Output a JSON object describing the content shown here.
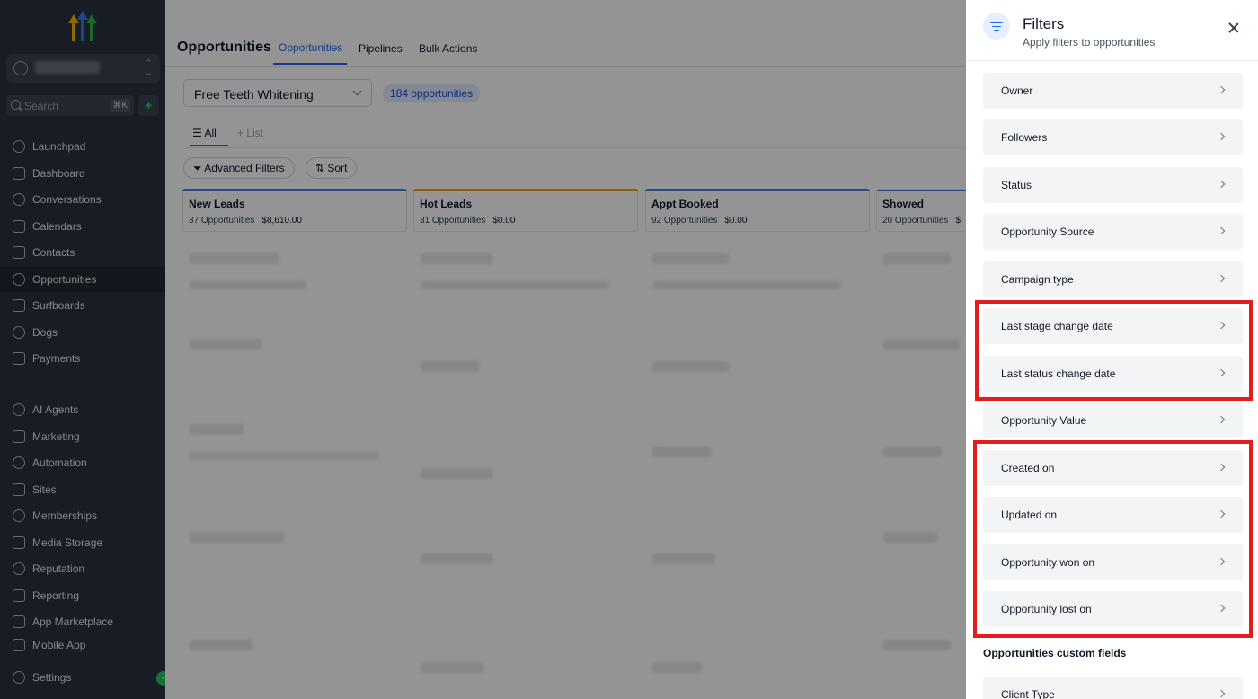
{
  "sidebar": {
    "search_placeholder": "Search",
    "search_shortcut": "⌘K",
    "items": [
      {
        "label": "Launchpad",
        "icon": "launchpad-icon"
      },
      {
        "label": "Dashboard",
        "icon": "dashboard-icon"
      },
      {
        "label": "Conversations",
        "icon": "chat-icon"
      },
      {
        "label": "Calendars",
        "icon": "calendar-icon"
      },
      {
        "label": "Contacts",
        "icon": "contacts-icon"
      },
      {
        "label": "Opportunities",
        "icon": "opportunities-icon",
        "active": true
      },
      {
        "label": "Surfboards",
        "icon": "surfboard-icon"
      },
      {
        "label": "Dogs",
        "icon": "dog-icon"
      },
      {
        "label": "Payments",
        "icon": "payments-icon"
      },
      {
        "label": "AI Agents",
        "icon": "ai-agents-icon"
      },
      {
        "label": "Marketing",
        "icon": "send-icon"
      },
      {
        "label": "Automation",
        "icon": "automation-icon"
      },
      {
        "label": "Sites",
        "icon": "sites-icon"
      },
      {
        "label": "Memberships",
        "icon": "memberships-icon"
      },
      {
        "label": "Media Storage",
        "icon": "media-icon"
      },
      {
        "label": "Reputation",
        "icon": "star-icon"
      },
      {
        "label": "Reporting",
        "icon": "reporting-icon"
      },
      {
        "label": "App Marketplace",
        "icon": "marketplace-icon"
      },
      {
        "label": "Mobile App",
        "icon": "mobile-icon"
      }
    ],
    "settings_label": "Settings"
  },
  "header": {
    "title": "Opportunities",
    "tabs": [
      "Opportunities",
      "Pipelines",
      "Bulk Actions"
    ]
  },
  "toolbar": {
    "pipeline": "Free Teeth Whitening",
    "count": "184 opportunities",
    "view_all": "All",
    "view_list": "List",
    "advanced_filters": "Advanced Filters",
    "sort": "Sort"
  },
  "columns": [
    {
      "title": "New Leads",
      "count": "37 Opportunities",
      "amount": "$8,610.00",
      "color": "#3b82f6"
    },
    {
      "title": "Hot Leads",
      "count": "31 Opportunities",
      "amount": "$0.00",
      "color": "#f59e0b"
    },
    {
      "title": "Appt Booked",
      "count": "92 Opportunities",
      "amount": "$0.00",
      "color": "#3b82f6"
    },
    {
      "title": "Showed",
      "count": "20 Opportunities",
      "amount": "$",
      "color": "#3b82f6"
    }
  ],
  "filters_panel": {
    "title": "Filters",
    "subtitle": "Apply filters to opportunities",
    "items": [
      "Owner",
      "Followers",
      "Status",
      "Opportunity Source",
      "Campaign type",
      "Last stage change date",
      "Last status change date",
      "Opportunity Value",
      "Created on",
      "Updated on",
      "Opportunity won on",
      "Opportunity lost on"
    ],
    "custom_section_title": "Opportunities custom fields",
    "custom_items": [
      "Client Type"
    ]
  },
  "colors": {
    "sidebar_bg": "#283140",
    "accent": "#2563eb",
    "highlight": "#e11d1d"
  }
}
